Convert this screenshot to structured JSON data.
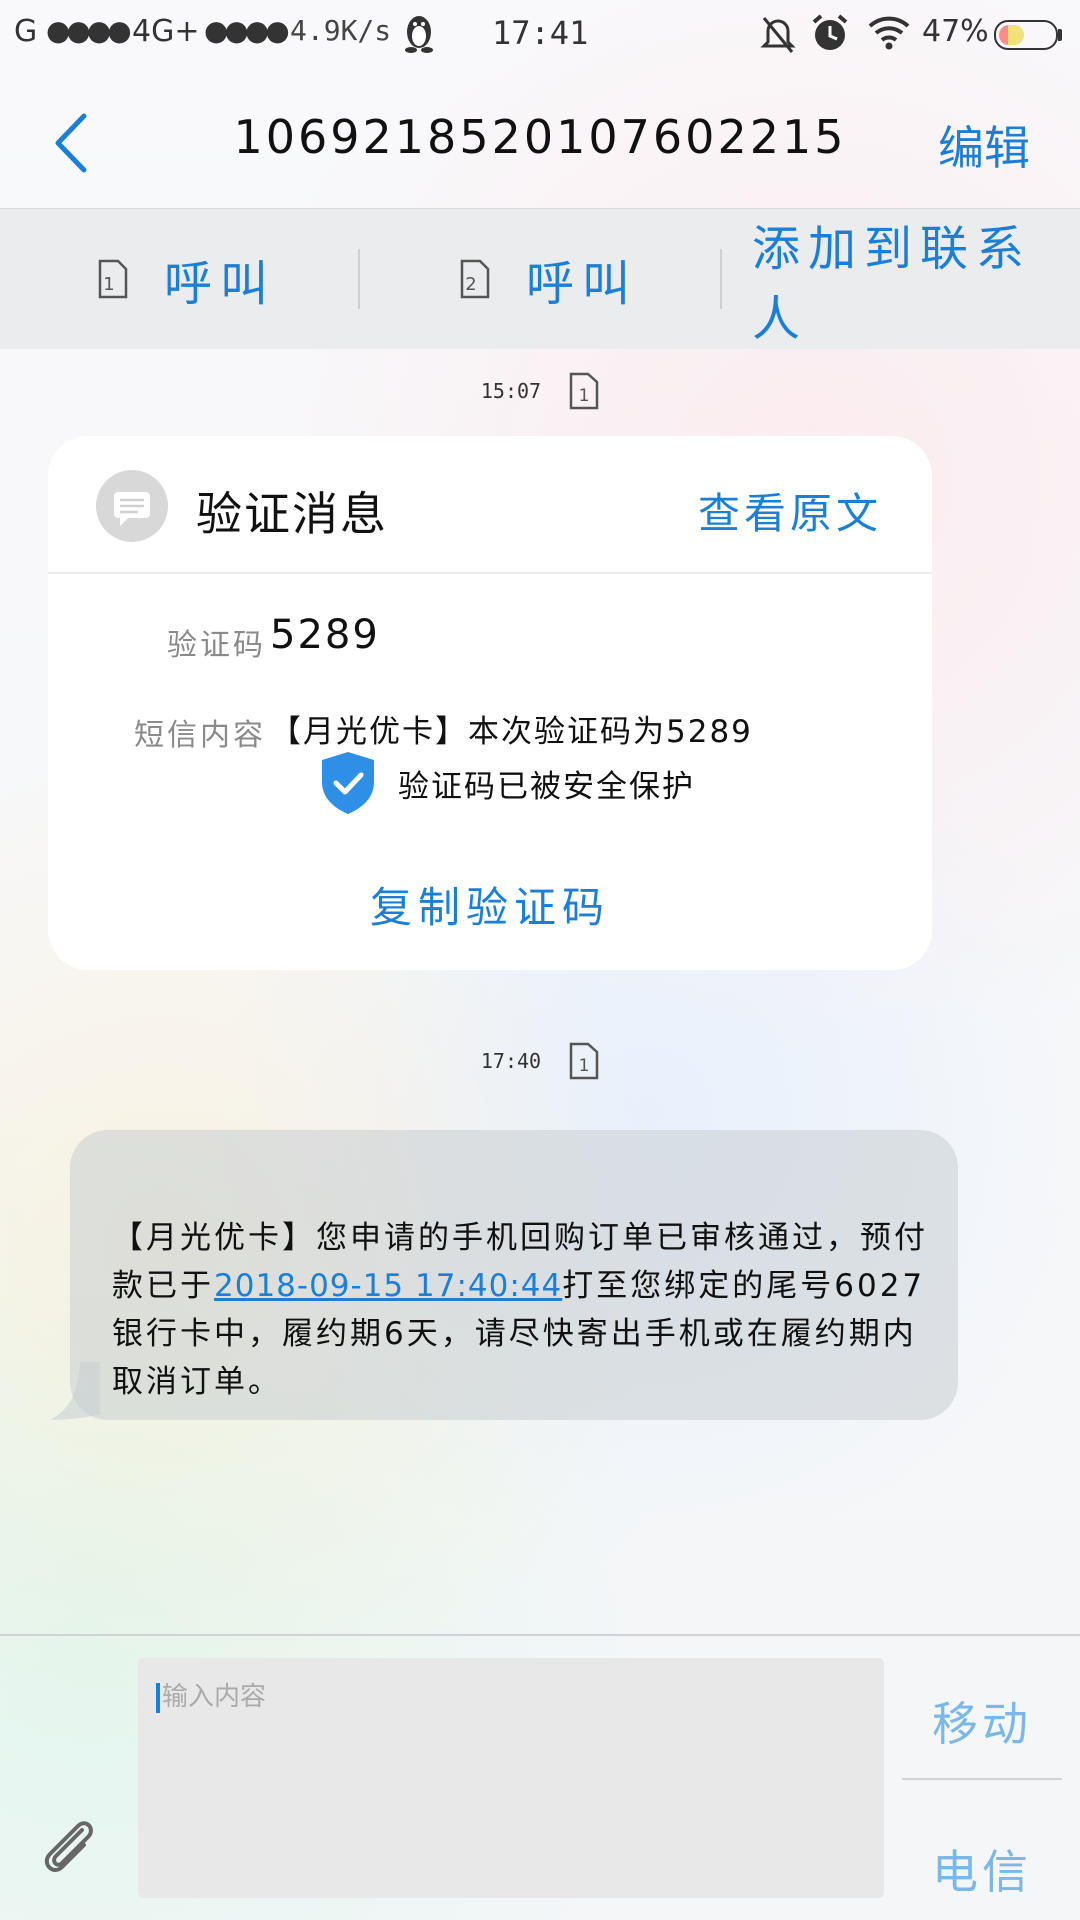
{
  "status_bar": {
    "carrier_1": "G",
    "network": "4G+",
    "net_speed": "4.9K/s",
    "time": "17:41",
    "battery": "47%",
    "battery_level": 0.47
  },
  "header": {
    "title": "1069218520107602215",
    "edit_label": "编辑"
  },
  "call_bar": {
    "sim1_label": "呼叫",
    "sim2_label": "呼叫",
    "add_contact_label": "添加到联系人",
    "sim1_number": "1",
    "sim2_number": "2"
  },
  "messages": [
    {
      "time": "15:07",
      "sim": "1",
      "card": {
        "title": "验证消息",
        "view_original": "查看原文",
        "code_label": "验证码",
        "code_value": "5289",
        "content_label": "短信内容",
        "content_value": "【月光优卡】本次验证码为5289",
        "protect_text": "验证码已被安全保护",
        "copy_label": "复制验证码"
      }
    },
    {
      "time": "17:40",
      "sim": "1",
      "text_before": "【月光优卡】您申请的手机回购订单已审核通过，预付款已于",
      "datetime_link": "2018-09-15 17:40:44",
      "text_after": "打至您绑定的尾号6027银行卡中，履约期6天，请尽快寄出手机或在履约期内取消订单。"
    }
  ],
  "composer": {
    "placeholder": "输入内容",
    "send_sim1": "移动",
    "send_sim2": "电信"
  },
  "colors": {
    "accent": "#1b7fd8",
    "send_button": "#7bb7e8",
    "bubble": "#c8cdd2"
  },
  "icons": {
    "back": "chevron-left-icon",
    "sim": "sim-card-icon",
    "message": "message-icon",
    "shield": "shield-check-icon",
    "attach": "paperclip-icon"
  }
}
